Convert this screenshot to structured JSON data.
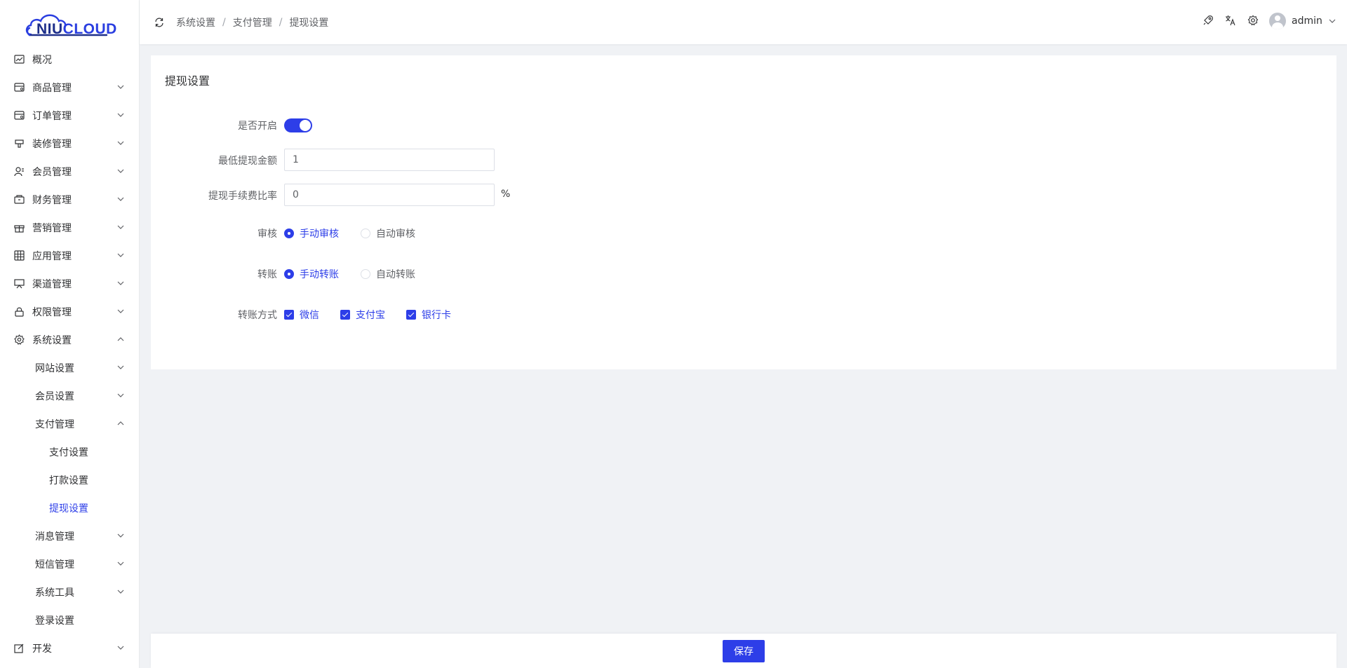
{
  "logo": {
    "text_left": "NIU",
    "text_right": "CLOUD"
  },
  "sidebar": {
    "items": [
      {
        "label": "概况",
        "icon": "chart-line-icon"
      },
      {
        "label": "商品管理",
        "icon": "goods-card-icon",
        "expandable": true
      },
      {
        "label": "订单管理",
        "icon": "order-card-icon",
        "expandable": true
      },
      {
        "label": "装修管理",
        "icon": "brush-icon",
        "expandable": true
      },
      {
        "label": "会员管理",
        "icon": "user-icon",
        "expandable": true
      },
      {
        "label": "财务管理",
        "icon": "wallet-icon",
        "expandable": true
      },
      {
        "label": "营销管理",
        "icon": "gift-icon",
        "expandable": true
      },
      {
        "label": "应用管理",
        "icon": "apps-grid-icon",
        "expandable": true
      },
      {
        "label": "渠道管理",
        "icon": "monitor-icon",
        "expandable": true
      },
      {
        "label": "权限管理",
        "icon": "lock-icon",
        "expandable": true
      },
      {
        "label": "系统设置",
        "icon": "gear-icon",
        "expandable": true,
        "expanded": true
      },
      {
        "label": "网站设置",
        "level": 2,
        "expandable": true
      },
      {
        "label": "会员设置",
        "level": 2,
        "expandable": true
      },
      {
        "label": "支付管理",
        "level": 2,
        "expandable": true,
        "expanded": true
      },
      {
        "label": "支付设置",
        "level": 3
      },
      {
        "label": "打款设置",
        "level": 3
      },
      {
        "label": "提现设置",
        "level": 3,
        "active": true
      },
      {
        "label": "消息管理",
        "level": 2,
        "expandable": true
      },
      {
        "label": "短信管理",
        "level": 2,
        "expandable": true
      },
      {
        "label": "系统工具",
        "level": 2,
        "expandable": true
      },
      {
        "label": "登录设置",
        "level": 2
      },
      {
        "label": "开发",
        "icon": "edit-icon",
        "expandable": true
      }
    ]
  },
  "header": {
    "breadcrumb": [
      "系统设置",
      "支付管理",
      "提现设置"
    ],
    "icons": [
      "rocket-icon",
      "translate-icon",
      "gear-icon"
    ],
    "user": "admin"
  },
  "form": {
    "title": "提现设置",
    "enable_label": "是否开启",
    "enabled": true,
    "min_amount_label": "最低提现金额",
    "min_amount_value": "1",
    "fee_rate_label": "提现手续费比率",
    "fee_rate_value": "0",
    "fee_rate_suffix": "%",
    "audit_label": "审核",
    "audit_options": [
      "手动审核",
      "自动审核"
    ],
    "audit_selected": "手动审核",
    "transfer_label": "转账",
    "transfer_options": [
      "手动转账",
      "自动转账"
    ],
    "transfer_selected": "手动转账",
    "transfer_method_label": "转账方式",
    "transfer_methods": [
      "微信",
      "支付宝",
      "银行卡"
    ]
  },
  "footer": {
    "save_label": "保存"
  },
  "colors": {
    "primary": "#2d3ee8",
    "background": "#f0f2f5"
  }
}
